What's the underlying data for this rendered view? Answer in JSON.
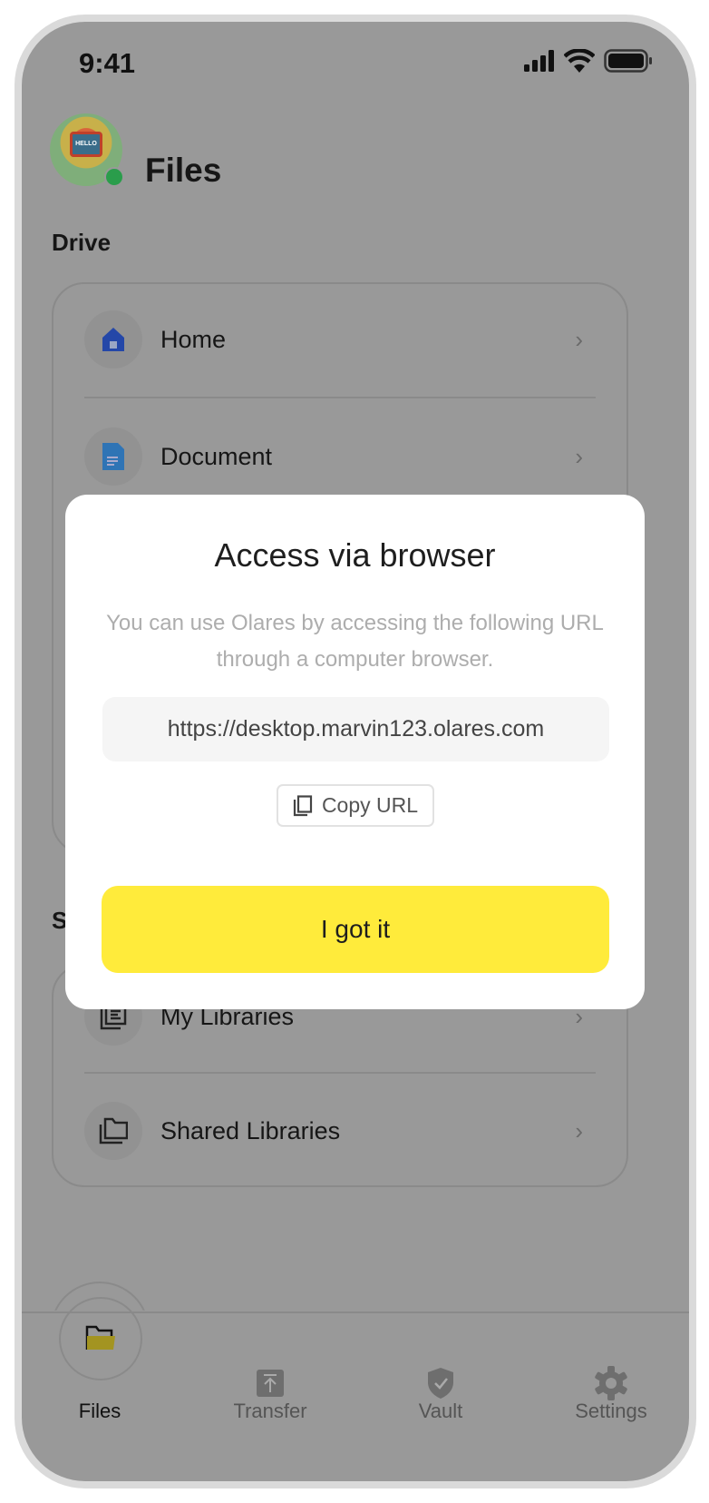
{
  "status_bar": {
    "time": "9:41",
    "icons": [
      "signal-icon",
      "wifi-icon",
      "battery-icon"
    ]
  },
  "header": {
    "title": "Files",
    "avatar_text": "HELLO",
    "online_color": "#2a9d4b"
  },
  "drive": {
    "label": "Drive",
    "items": [
      {
        "label": "Home",
        "icon": "home-icon",
        "color": "#2447a8"
      },
      {
        "label": "Document",
        "icon": "document-icon",
        "color": "#2f74b5"
      }
    ]
  },
  "sync": {
    "label": "Sync",
    "items": [
      {
        "label": "My Libraries",
        "icon": "library-icon"
      },
      {
        "label": "Shared Libraries",
        "icon": "shared-folder-icon"
      }
    ]
  },
  "nav": [
    {
      "label": "Files",
      "icon": "folder-icon",
      "active": true
    },
    {
      "label": "Transfer",
      "icon": "transfer-icon"
    },
    {
      "label": "Vault",
      "icon": "vault-shield-icon"
    },
    {
      "label": "Settings",
      "icon": "gear-icon"
    }
  ],
  "modal": {
    "title": "Access via browser",
    "description": "You can use Olares by accessing the following URL through a computer browser.",
    "url": "https://desktop.marvin123.olares.com",
    "copy_label": "Copy URL",
    "confirm_label": "I got it",
    "accent": "#ffeb3b"
  }
}
